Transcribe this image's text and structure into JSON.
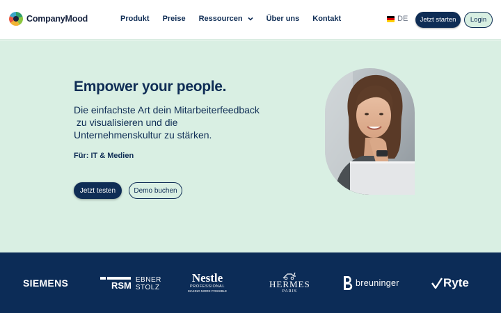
{
  "header": {
    "brand": "CompanyMood",
    "nav": [
      {
        "label": "Produkt"
      },
      {
        "label": "Preise"
      },
      {
        "label": "Ressourcen",
        "has_dropdown": true
      },
      {
        "label": "Über uns"
      },
      {
        "label": "Kontakt"
      }
    ],
    "language": "DE",
    "cta_label": "Jetzt starten",
    "login_label": "Login"
  },
  "hero": {
    "title": "Empower your people.",
    "subtitle_lines": [
      "Die einfachste Art dein Mitarbeiterfeedback",
      " zu visualisieren und die",
      "Unternehmenskultur zu stärken."
    ],
    "target": "Für: IT & Medien",
    "primary_button": "Jetzt testen",
    "secondary_button": "Demo buchen"
  },
  "clients": [
    {
      "name": "SIEMENS"
    },
    {
      "name": "RSM",
      "sub": [
        "EBNER",
        "STOLZ"
      ]
    },
    {
      "name": "Nestle",
      "sub": [
        "PROFESSIONAL",
        "MAKING MORE POSSIBLE"
      ]
    },
    {
      "name": "HERMES",
      "sub": [
        "PARIS"
      ]
    },
    {
      "name": "breuninger"
    },
    {
      "name": "Ryte"
    }
  ],
  "colors": {
    "primary": "#0f2d55",
    "hero_bg": "#d9efe3",
    "logos_bg": "#0c2c57"
  }
}
